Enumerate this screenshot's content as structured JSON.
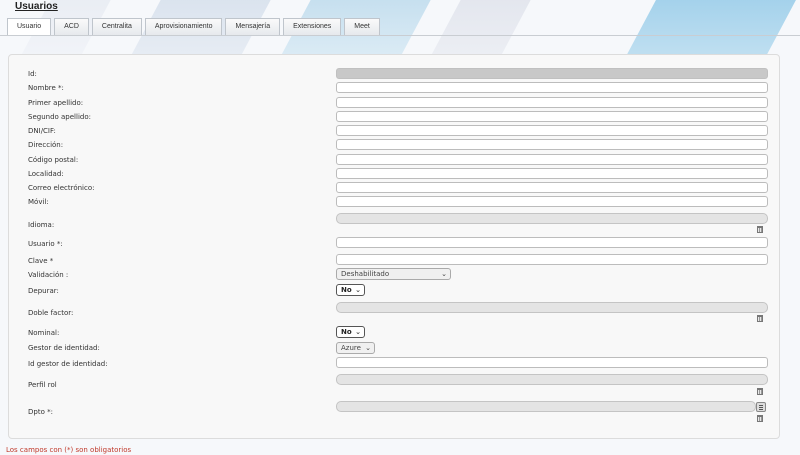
{
  "page": {
    "title": "Usuarios"
  },
  "tabs": [
    "Usuario",
    "ACD",
    "Centralita",
    "Aprovisionamiento",
    "Mensajería",
    "Extensiones",
    "Meet"
  ],
  "fields": {
    "id": "Id:",
    "nombre": "Nombre *:",
    "primer_apellido": "Primer apellido:",
    "segundo_apellido": "Segundo apellido:",
    "dni": "DNI/CIF:",
    "direccion": "Dirección:",
    "codigo_postal": "Código postal:",
    "localidad": "Localidad:",
    "correo": "Correo electrónico:",
    "movil": "Móvil:",
    "idioma": "Idioma:",
    "usuario": "Usuario *:",
    "clave": "Clave *",
    "validacion": "Validación :",
    "depurar": "Depurar:",
    "doble_factor": "Doble factor:",
    "nominal": "Nominal:",
    "gestor_identidad": "Gestor de identidad:",
    "id_gestor_identidad": "Id gestor de identidad:",
    "perfil_rol": "Perfil rol",
    "dpto": "Dpto *:"
  },
  "values": {
    "validacion": "Deshabilitado",
    "depurar": "No",
    "nominal": "No",
    "gestor_identidad": "Azure"
  },
  "footer": {
    "note": "Los campos con (*) son obligatorios"
  }
}
